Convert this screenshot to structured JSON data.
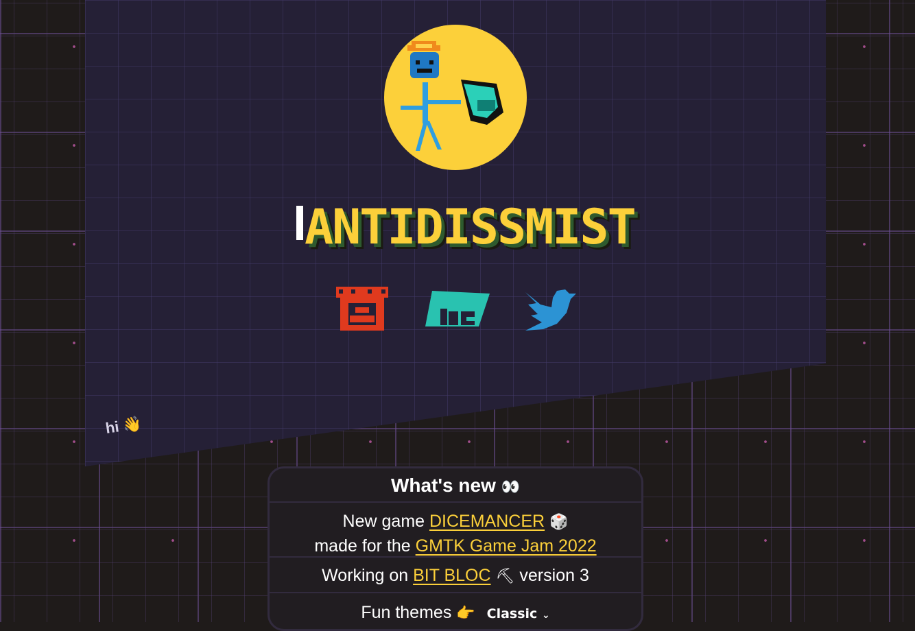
{
  "header": {
    "logo_text": "ANTIDISSMIST",
    "avatar_alt": "stick figure with hard hat and pickaxe"
  },
  "social": [
    {
      "name": "itch.io",
      "icon": "itchio-icon",
      "color": "#e03a1e"
    },
    {
      "name": "Homebrew Channel",
      "icon": "hc-icon",
      "color": "#29c2b0"
    },
    {
      "name": "Twitter",
      "icon": "twitter-icon",
      "color": "#2c93d4"
    }
  ],
  "greeting": {
    "text": "hi",
    "emoji": "👋"
  },
  "whats_new": {
    "title": "What's new",
    "title_emoji": "👀",
    "item1": {
      "prefix": "New game",
      "link": "DICEMANCER",
      "emoji": "🎲",
      "line2_prefix": "made for the",
      "line2_link": "GMTK Game Jam 2022"
    },
    "item2": {
      "prefix": "Working on",
      "link": "BIT BLOC",
      "emoji": "⛏",
      "suffix": "version 3"
    },
    "item3": {
      "label": "Fun themes",
      "emoji": "👉",
      "selected_theme": "Classic"
    }
  },
  "colors": {
    "accent": "#fcd03a",
    "background": "#1f1b1a",
    "panel": "#252036"
  }
}
